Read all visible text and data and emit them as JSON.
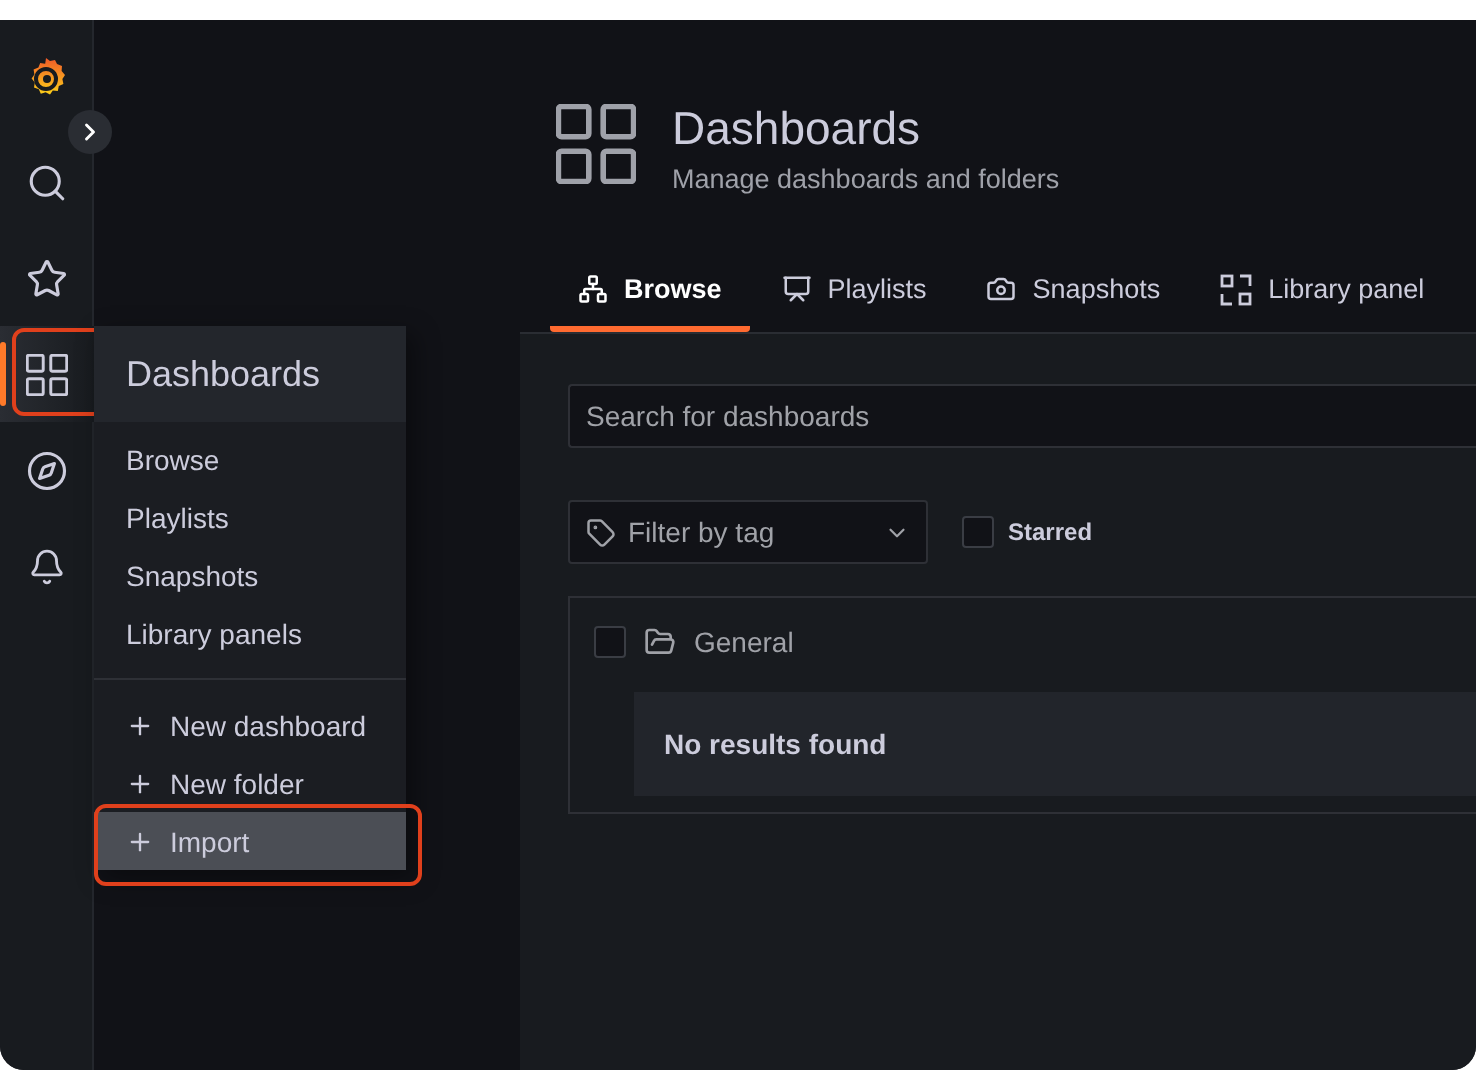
{
  "sidebar": {
    "items": [
      {
        "kind": "logo",
        "selected": false,
        "annotated": false
      },
      {
        "kind": "search",
        "selected": false,
        "annotated": false
      },
      {
        "kind": "starred",
        "selected": false,
        "annotated": false
      },
      {
        "kind": "dashboards",
        "selected": true,
        "annotated": true
      },
      {
        "kind": "explore",
        "selected": false,
        "annotated": false
      },
      {
        "kind": "alerting",
        "selected": false,
        "annotated": false
      }
    ]
  },
  "flyout": {
    "title": "Dashboards",
    "items": [
      {
        "label": "Browse"
      },
      {
        "label": "Playlists"
      },
      {
        "label": "Snapshots"
      },
      {
        "label": "Library panels"
      }
    ],
    "actions": [
      {
        "label": "New dashboard",
        "selected": false,
        "annotated": false
      },
      {
        "label": "New folder",
        "selected": false,
        "annotated": false
      },
      {
        "label": "Import",
        "selected": true,
        "annotated": true
      }
    ]
  },
  "page": {
    "title": "Dashboards",
    "subtitle": "Manage dashboards and folders",
    "tabs": [
      {
        "label": "Browse",
        "kind": "browse",
        "selected": true
      },
      {
        "label": "Playlists",
        "kind": "playlists",
        "selected": false
      },
      {
        "label": "Snapshots",
        "kind": "snapshots",
        "selected": false
      },
      {
        "label": "Library panel",
        "kind": "library",
        "selected": false
      }
    ],
    "search": {
      "placeholder": "Search for dashboards"
    },
    "filter": {
      "placeholder": "Filter by tag"
    },
    "starred": {
      "label": "Starred",
      "checked": false
    },
    "folders": [
      {
        "name": "General",
        "checked": false,
        "empty_message": "No results found"
      }
    ]
  }
}
